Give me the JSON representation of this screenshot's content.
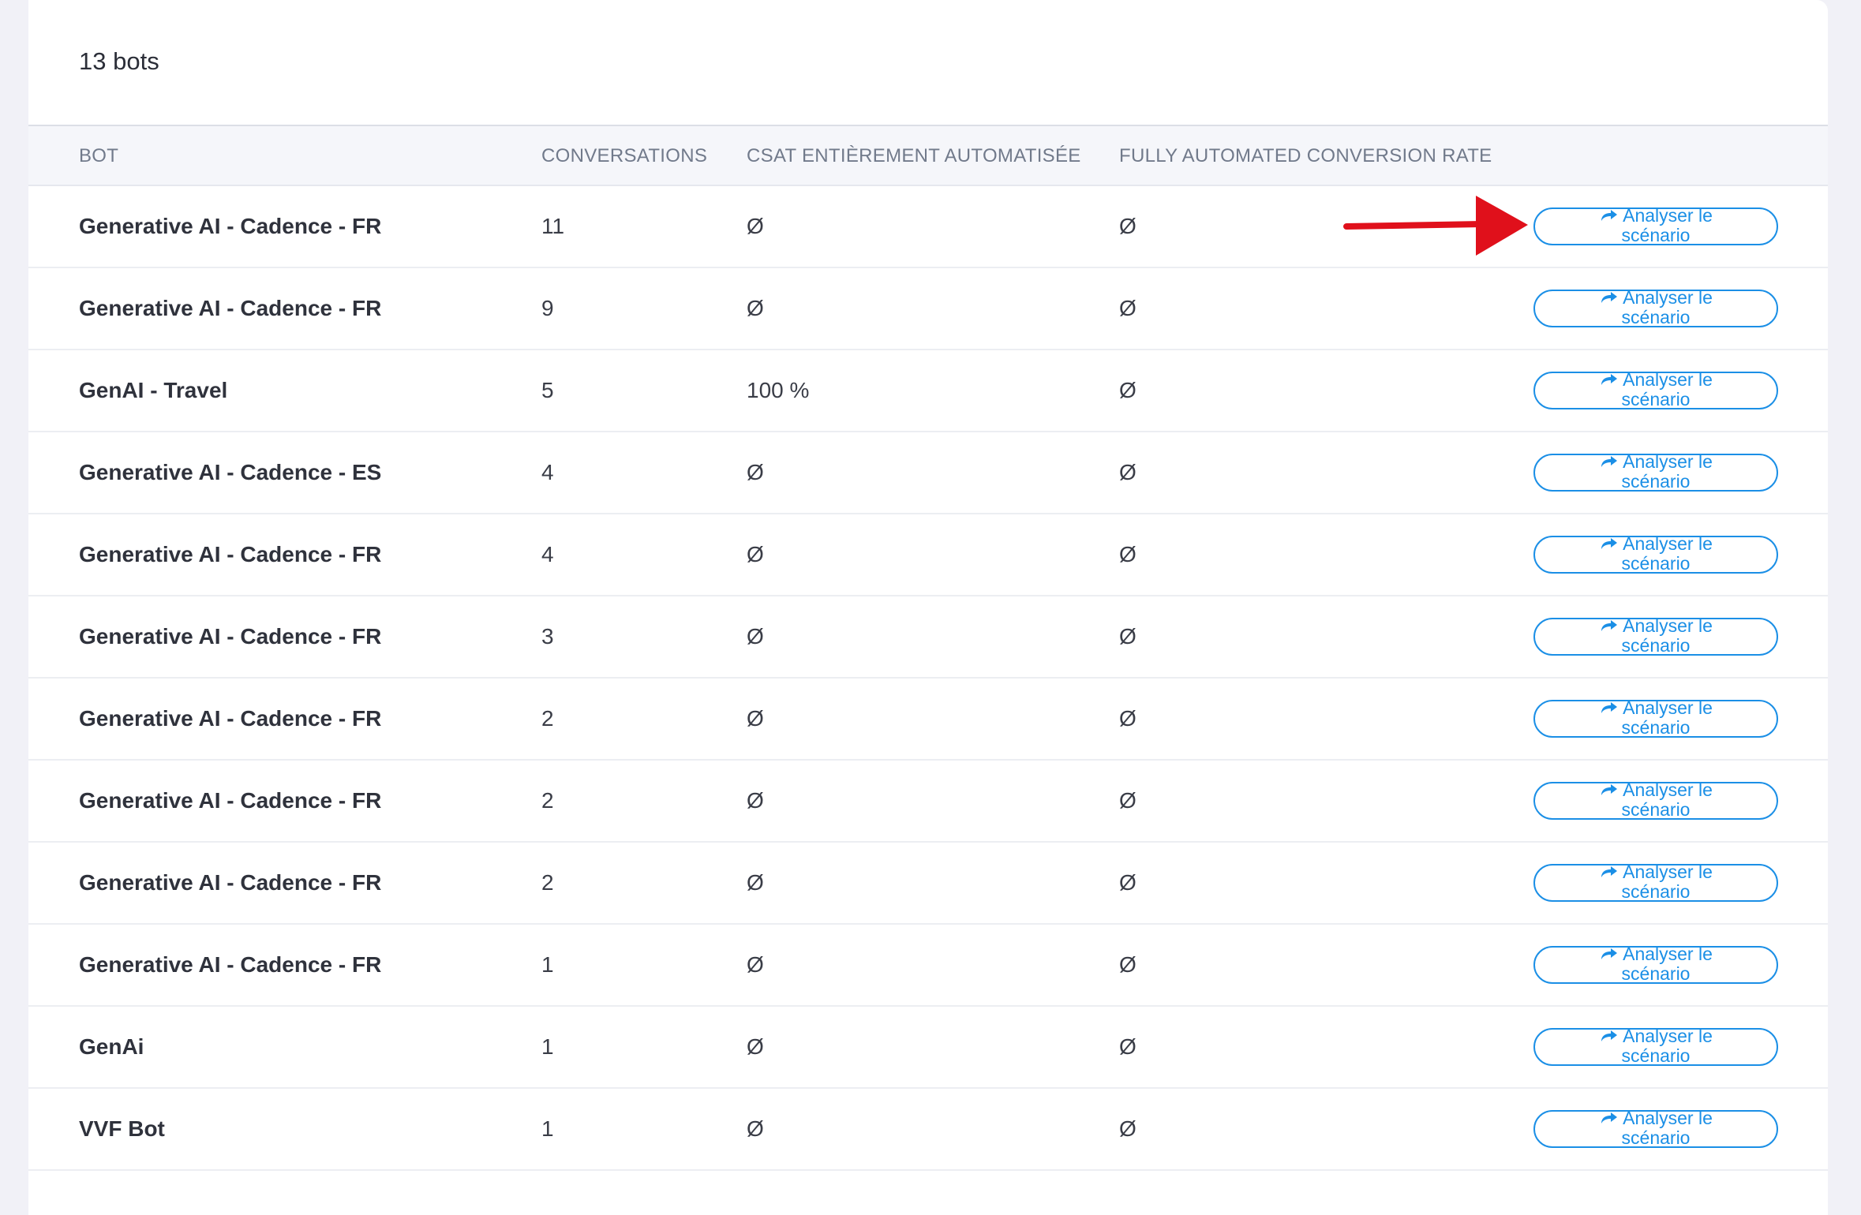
{
  "panel": {
    "title": "13 bots"
  },
  "table": {
    "columns": {
      "bot": "BOT",
      "conversations": "CONVERSATIONS",
      "csat": "CSAT ENTIÈREMENT AUTOMATISÉE",
      "conversion": "FULLY AUTOMATED CONVERSION RATE"
    },
    "action_label_line1": "Analyser le",
    "action_label_line2": "scénario",
    "rows": [
      {
        "bot": "Generative AI - Cadence - FR",
        "conversations": "11",
        "csat": "Ø",
        "conversion": "Ø"
      },
      {
        "bot": "Generative AI - Cadence - FR",
        "conversations": "9",
        "csat": "Ø",
        "conversion": "Ø"
      },
      {
        "bot": "GenAI - Travel",
        "conversations": "5",
        "csat": "100 %",
        "conversion": "Ø"
      },
      {
        "bot": "Generative AI - Cadence - ES",
        "conversations": "4",
        "csat": "Ø",
        "conversion": "Ø"
      },
      {
        "bot": "Generative AI - Cadence - FR",
        "conversations": "4",
        "csat": "Ø",
        "conversion": "Ø"
      },
      {
        "bot": "Generative AI - Cadence - FR",
        "conversations": "3",
        "csat": "Ø",
        "conversion": "Ø"
      },
      {
        "bot": "Generative AI - Cadence - FR",
        "conversations": "2",
        "csat": "Ø",
        "conversion": "Ø"
      },
      {
        "bot": "Generative AI - Cadence - FR",
        "conversations": "2",
        "csat": "Ø",
        "conversion": "Ø"
      },
      {
        "bot": "Generative AI - Cadence - FR",
        "conversations": "2",
        "csat": "Ø",
        "conversion": "Ø"
      },
      {
        "bot": "Generative AI - Cadence - FR",
        "conversations": "1",
        "csat": "Ø",
        "conversion": "Ø"
      },
      {
        "bot": "GenAi",
        "conversations": "1",
        "csat": "Ø",
        "conversion": "Ø"
      },
      {
        "bot": "VVF Bot",
        "conversations": "1",
        "csat": "Ø",
        "conversion": "Ø"
      }
    ]
  },
  "colors": {
    "accent": "#1b8fe6",
    "annotation_arrow": "#e0101b",
    "page_background": "#f1f1f7",
    "header_background": "#f5f6fa"
  },
  "icons": {
    "action": "share-arrow-icon",
    "annotation": "red-arrow-annotation"
  }
}
